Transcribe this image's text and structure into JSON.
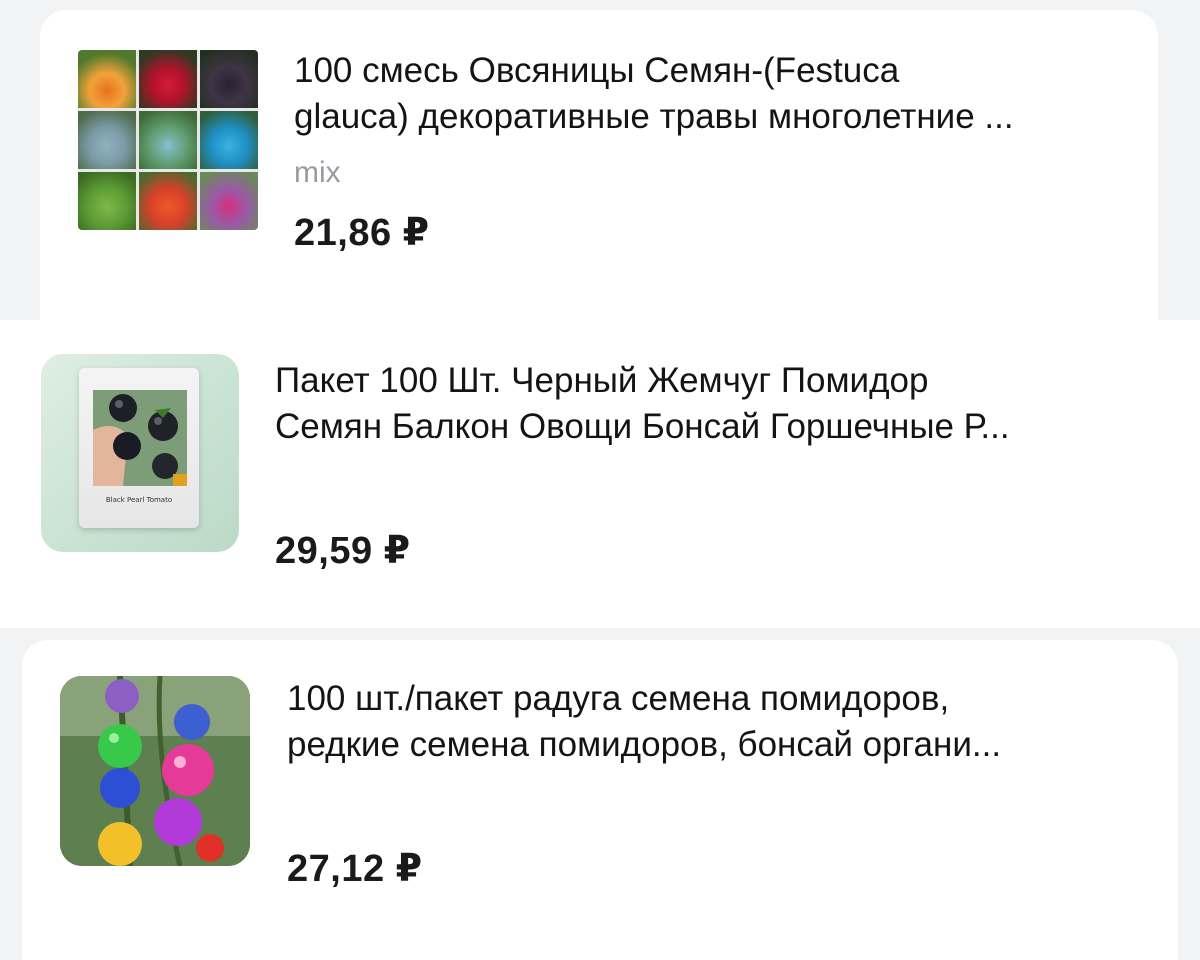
{
  "products": [
    {
      "title_line1": "100 смесь Овсяницы Семян-(Festuca",
      "title_line2": "glauca) декоративные травы многолетние ...",
      "variant": "mix",
      "price": "21,86 ₽"
    },
    {
      "title_line1": "Пакет 100 Шт. Черный Жемчуг Помидор",
      "title_line2": "Семян Балкон Овощи Бонсай Горшечные Р...",
      "packet_label": "Black Pearl Tomato",
      "price": "29,59 ₽"
    },
    {
      "title_line1": "100 шт./пакет радуга семена помидоров,",
      "title_line2": "редкие семена помидоров, бонсай органи...",
      "price": "27,12 ₽"
    }
  ],
  "colors": {
    "background": "#ffffff",
    "card_surround": "#f2f3f5",
    "text": "#141414",
    "variant_text": "#9a9aa0"
  }
}
